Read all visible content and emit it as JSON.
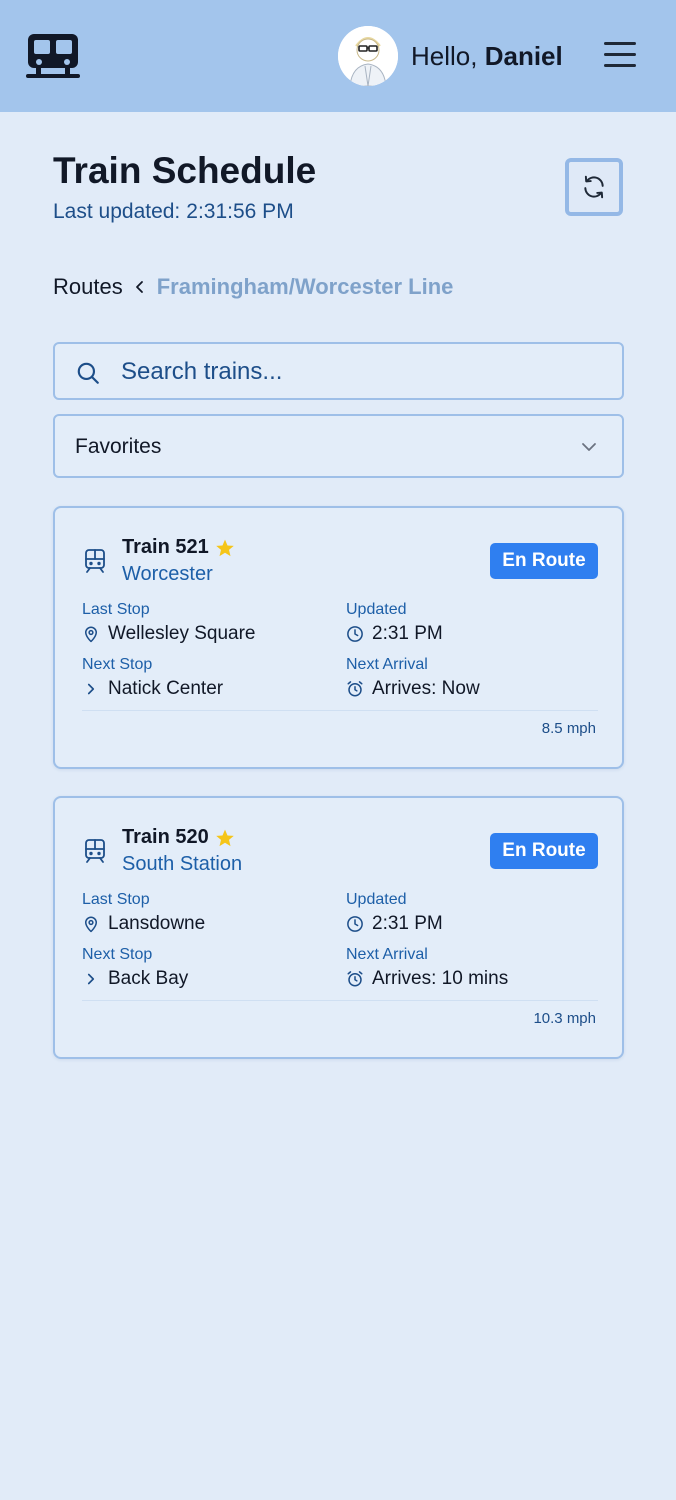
{
  "header": {
    "logo_icon": "train-front-icon",
    "avatar_icon": "user-avatar",
    "greeting_prefix": "Hello,",
    "user_name": "Daniel",
    "menu_icon": "hamburger-menu-icon"
  },
  "page": {
    "title": "Train Schedule",
    "last_updated_label": "Last updated:",
    "last_updated_time": "2:31:56 PM",
    "refresh_icon": "refresh-icon"
  },
  "breadcrumb": {
    "root": "Routes",
    "current": "Framingham/Worcester Line"
  },
  "search": {
    "placeholder": "Search trains...",
    "value": ""
  },
  "filter": {
    "selected": "Favorites"
  },
  "colors": {
    "header_bg": "#a3c5ec",
    "page_bg": "#e1ebf8",
    "accent": "#2f7ff0",
    "star": "#f5c518"
  },
  "trains": [
    {
      "name": "Train 521",
      "favorite": true,
      "destination": "Worcester",
      "status": "En Route",
      "last_stop_label": "Last Stop",
      "last_stop": "Wellesley Square",
      "updated_label": "Updated",
      "updated": "2:31 PM",
      "next_stop_label": "Next Stop",
      "next_stop": "Natick Center",
      "next_arrival_label": "Next Arrival",
      "next_arrival": "Arrives: Now",
      "speed": "8.5 mph"
    },
    {
      "name": "Train 520",
      "favorite": true,
      "destination": "South Station",
      "status": "En Route",
      "last_stop_label": "Last Stop",
      "last_stop": "Lansdowne",
      "updated_label": "Updated",
      "updated": "2:31 PM",
      "next_stop_label": "Next Stop",
      "next_stop": "Back Bay",
      "next_arrival_label": "Next Arrival",
      "next_arrival": "Arrives: 10 mins",
      "speed": "10.3 mph"
    }
  ]
}
